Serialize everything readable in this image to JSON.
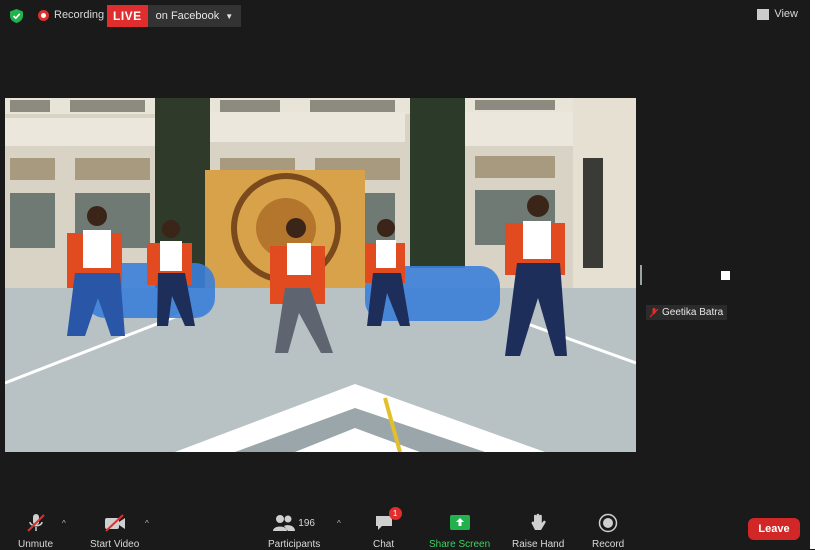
{
  "topbar": {
    "recording_label": "Recording",
    "live_badge": "LIVE",
    "live_destination": "on Facebook",
    "view_label": "View"
  },
  "participant": {
    "name": "Geetika Batra"
  },
  "toolbar": {
    "unmute": "Unmute",
    "start_video": "Start Video",
    "participants": "Participants",
    "participants_count": "196",
    "chat": "Chat",
    "chat_badge": "1",
    "share_screen": "Share Screen",
    "raise_hand": "Raise Hand",
    "record": "Record",
    "leave": "Leave"
  },
  "colors": {
    "live_red": "#e02e2e",
    "share_green": "#3ad35f",
    "leave_red": "#d12727"
  },
  "icons": {
    "secure": "shield-check-icon",
    "recording": "record-dot-icon",
    "view": "view-grid-icon",
    "mic": "mic-off-icon",
    "video": "video-off-icon",
    "participants": "participants-icon",
    "chat": "chat-bubble-icon",
    "share": "share-screen-icon",
    "hand": "raise-hand-icon",
    "record": "record-icon"
  }
}
